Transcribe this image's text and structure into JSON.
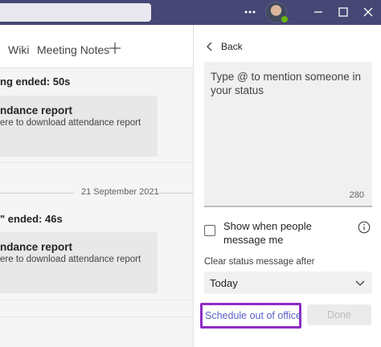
{
  "chat": {
    "messages": [
      {
        "ended_text": "ng ended: 50s",
        "card_title": "ndance report",
        "card_sub": "ere to download attendance report"
      },
      {
        "ended_text": "\" ended: 46s",
        "card_title": "ndance report",
        "card_sub": "ere to download attendance report"
      }
    ],
    "date_separator": "21 September 2021"
  },
  "tabs": {
    "wiki": "Wiki",
    "meeting_notes": "Meeting Notes",
    "add_icon": "plus-icon"
  },
  "titlebar": {
    "more_icon": "ellipsis-icon",
    "avatar_status": "available"
  },
  "status_panel": {
    "back_label": "Back",
    "placeholder": "Type @ to mention someone in your status",
    "char_count": "280",
    "checkbox_label": "Show when people message me",
    "checkbox_checked": false,
    "clear_after_label": "Clear status message after",
    "clear_after_value": "Today",
    "schedule_label": "Schedule out of office",
    "done_label": "Done"
  },
  "colors": {
    "titlebar": "#464775",
    "accent": "#5b5fc7",
    "highlight": "#8e2cc5",
    "presence": "#6bb700"
  }
}
